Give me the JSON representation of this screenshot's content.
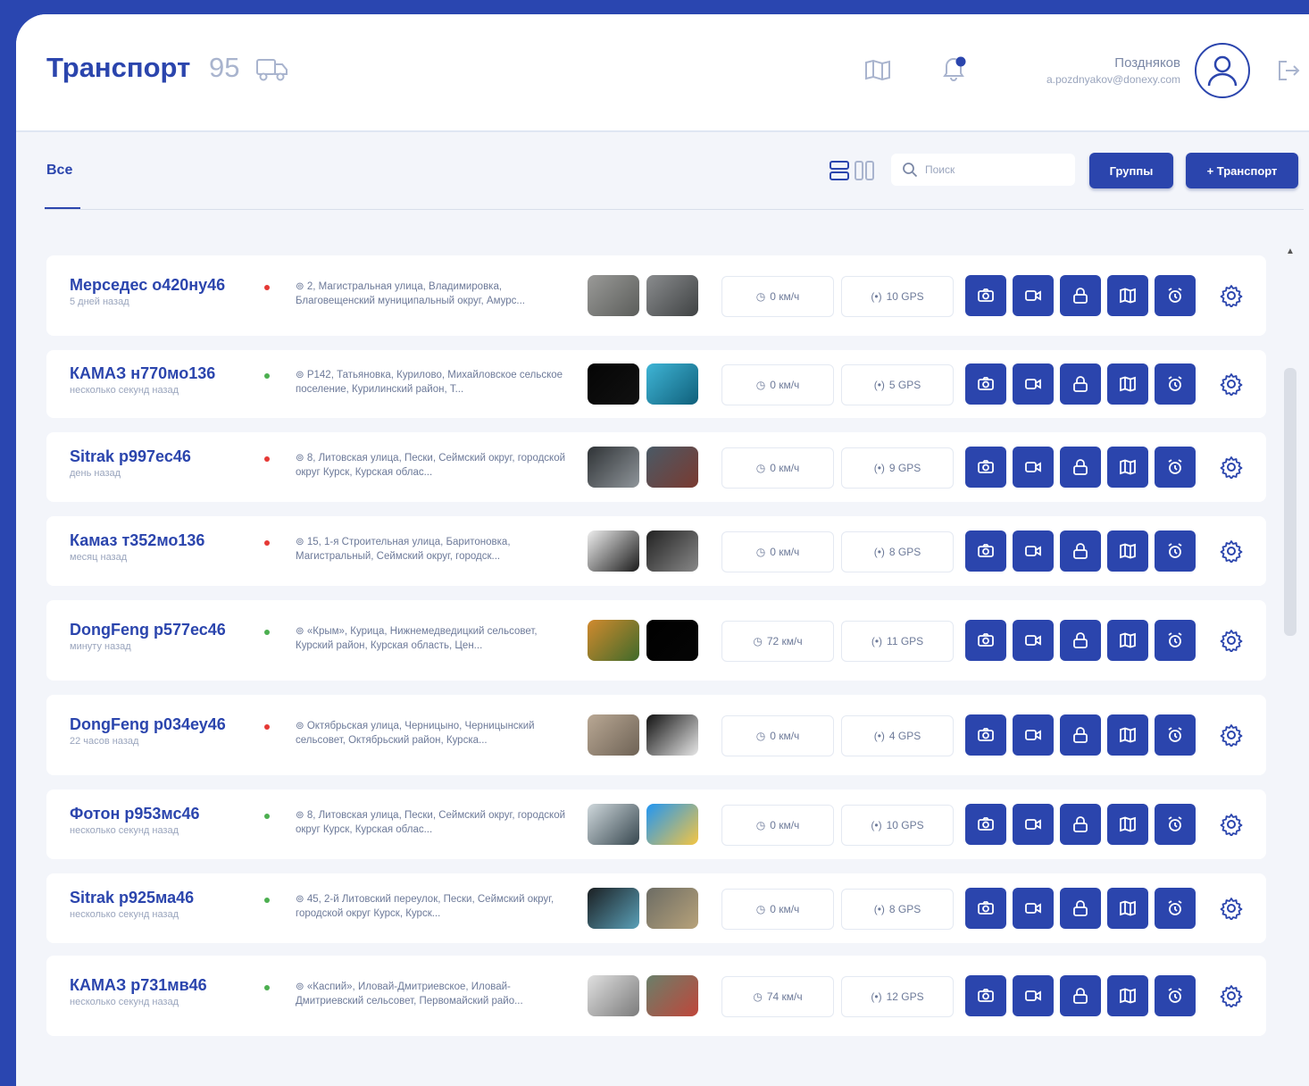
{
  "header": {
    "title": "Транспорт",
    "count": "95",
    "user_name": "Поздняков",
    "user_email": "a.pozdnyakov@donexy.com"
  },
  "toolbar": {
    "tab_all": "Все",
    "search_placeholder": "Поиск",
    "groups_label": "Группы",
    "add_label": "+ Транспорт"
  },
  "colors": {
    "accent": "#2b45ad",
    "frame": "#2a46b0",
    "status_online": "#4caf50",
    "status_offline": "#e53935"
  },
  "vehicles": [
    {
      "name": "Мерседес о420ну46",
      "ago": "5 дней назад",
      "status": "offline",
      "address": "2, Магистральная улица, Владимировка, Благовещенский муниципальный округ, Амурс...",
      "speed": "0 км/ч",
      "gps": "10 GPS",
      "thumb1": [
        "#9a9a98",
        "#5b5d5a"
      ],
      "thumb2": [
        "#8a8c8e",
        "#3f4243"
      ]
    },
    {
      "name": "КАМАЗ н770мо136",
      "ago": "несколько секунд назад",
      "status": "online",
      "address": "Р142, Татьяновка, Курилово, Михайловское сельское поселение, Курилинский район, Т...",
      "speed": "0 км/ч",
      "gps": "5 GPS",
      "thumb1": [
        "#050505",
        "#111"
      ],
      "thumb2": [
        "#3fb5d6",
        "#0f5f7a"
      ]
    },
    {
      "name": "Sitrak р997ес46",
      "ago": "день назад",
      "status": "offline",
      "address": "8, Литовская улица, Пески, Сеймский округ, городской округ Курск, Курская облас...",
      "speed": "0 км/ч",
      "gps": "9 GPS",
      "thumb1": [
        "#2f3336",
        "#8f959a"
      ],
      "thumb2": [
        "#4a5a66",
        "#7a3a30"
      ]
    },
    {
      "name": "Камаз т352мо136",
      "ago": "месяц назад",
      "status": "offline",
      "address": "15, 1-я Строительная улица, Баритоновка, Магистральный, Сеймский округ, городск...",
      "speed": "0 км/ч",
      "gps": "8 GPS",
      "thumb1": [
        "#efefef",
        "#1a1a1a"
      ],
      "thumb2": [
        "#222",
        "#888"
      ]
    },
    {
      "name": "DongFeng р577ес46",
      "ago": "минуту назад",
      "status": "online",
      "address": "«Крым», Курица, Нижнемедведицкий сельсовет, Курский район, Курская область, Цен...",
      "speed": "72 км/ч",
      "gps": "11 GPS",
      "thumb1": [
        "#d18a2e",
        "#3f6a2a"
      ],
      "thumb2": [
        "#000",
        "#050505"
      ]
    },
    {
      "name": "DongFeng р034еу46",
      "ago": "22 часов назад",
      "status": "offline",
      "address": "Октябрьская улица, Черницыно, Черницынский сельсовет, Октябрьский район, Курска...",
      "speed": "0 км/ч",
      "gps": "4 GPS",
      "thumb1": [
        "#b9a894",
        "#6e6255"
      ],
      "thumb2": [
        "#111",
        "#e7e7e7"
      ]
    },
    {
      "name": "Фотон р953мс46",
      "ago": "несколько секунд назад",
      "status": "online",
      "address": "8, Литовская улица, Пески, Сеймский округ, городской округ Курск, Курская облас...",
      "speed": "0 км/ч",
      "gps": "10 GPS",
      "thumb1": [
        "#cfd8dc",
        "#37474f"
      ],
      "thumb2": [
        "#2196f3",
        "#f4c542"
      ]
    },
    {
      "name": "Sitrak р925ма46",
      "ago": "несколько секунд назад",
      "status": "online",
      "address": "45, 2-й Литовский переулок, Пески, Сеймский округ, городской округ Курск, Курск...",
      "speed": "0 км/ч",
      "gps": "8 GPS",
      "thumb1": [
        "#1b1f22",
        "#5aa0b8"
      ],
      "thumb2": [
        "#6c6c64",
        "#b7a27a"
      ]
    },
    {
      "name": "КАМАЗ р731мв46",
      "ago": "несколько секунд назад",
      "status": "online",
      "address": "«Каспий», Иловай-Дмитриевское, Иловай-Дмитриевский сельсовет, Первомайский райо...",
      "speed": "74 км/ч",
      "gps": "12 GPS",
      "thumb1": [
        "#e0e0e0",
        "#7b7b7b"
      ],
      "thumb2": [
        "#6a7f6a",
        "#c0463a"
      ]
    }
  ]
}
